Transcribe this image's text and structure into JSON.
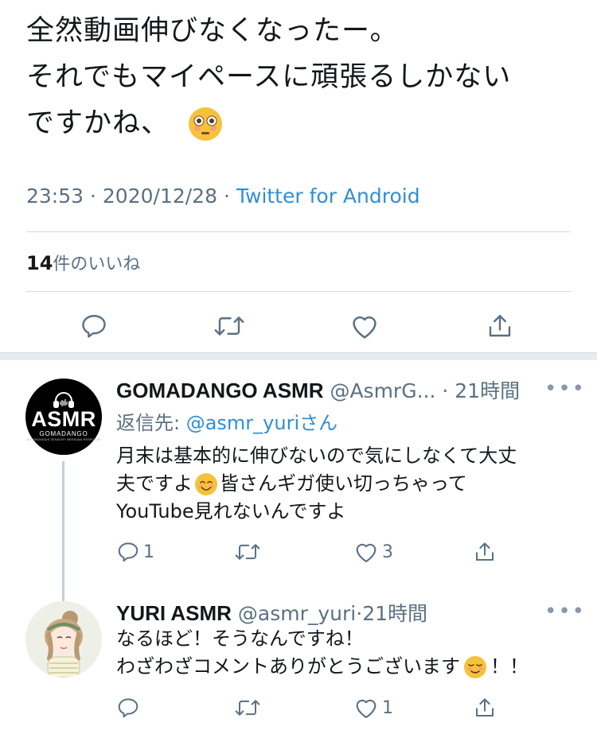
{
  "main_tweet": {
    "lines": [
      "全然動画伸びなくなったー。",
      "それでもマイペースに頑張るしかない",
      "ですかね、"
    ],
    "emoji": "flushed-face",
    "time": "23:53",
    "dot": "·",
    "date": "2020/12/28",
    "source": "Twitter for Android",
    "likes_count": "14",
    "likes_label": "件のいいね"
  },
  "replies": [
    {
      "name": "GOMADANGO ASMR",
      "handle": "@AsmrG...",
      "age": "21時間",
      "reply_to_label": "返信先: ",
      "reply_to_handle": "@asmr_yuri",
      "reply_to_suffix": "さん",
      "lines": [
        "月末は基本的に伸びないので気にしなくて大丈",
        "夫ですよ",
        "皆さんギガ使い切っちゃって",
        "YouTube見れないんですよ"
      ],
      "emoji": "smiling-face-with-smiling-eyes",
      "avatar": {
        "big": "ASMR",
        "sub": "GOMADANGO",
        "tiny": "AUTONOMOUS SENSORY MERIDIAN RESPONSE"
      },
      "reply_count": "1",
      "like_count": "3"
    },
    {
      "name": "YURI ASMR",
      "handle": "@asmr_yuri",
      "age": "21時間",
      "lines": [
        "なるほど！そうなんですね！",
        "わざわざコメントありがとうございます",
        "！！"
      ],
      "emoji": "smiling-face",
      "like_count": "1"
    }
  ],
  "more_label": "•••",
  "colors": {
    "link": "#2f8fd6",
    "secondary": "#5b7083",
    "icon": "#5b7083"
  }
}
